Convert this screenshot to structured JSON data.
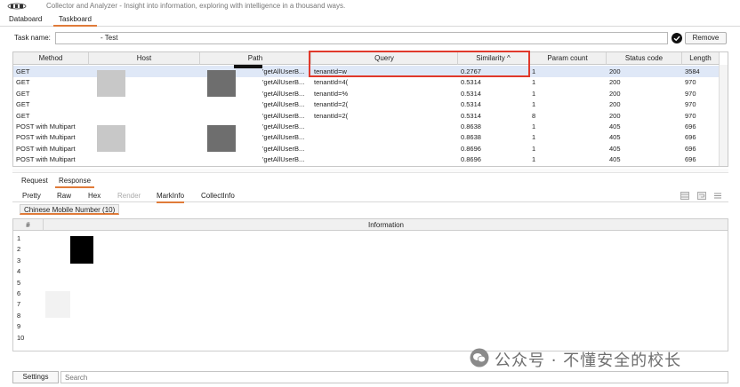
{
  "app": {
    "tagline": "Collector and Analyzer - Insight into information, exploring with intelligence in a thousand ways."
  },
  "main_tabs": [
    {
      "label": "Databoard"
    },
    {
      "label": "Taskboard"
    }
  ],
  "task": {
    "label": "Task name:",
    "value": "- Test",
    "remove_label": "Remove"
  },
  "table": {
    "columns": [
      "Method",
      "Host",
      "Path",
      "Query",
      "Similarity ^",
      "Param count",
      "Status code",
      "Length"
    ],
    "rows": [
      {
        "method": "GET",
        "host": "",
        "path": "'getAllUserB...",
        "query": "tenantId=w",
        "similarity": "0.2767",
        "param_count": "1",
        "status": "200",
        "length": "3584"
      },
      {
        "method": "GET",
        "host": "",
        "path": "'getAllUserB...",
        "query": "tenantId=4(",
        "similarity": "0.5314",
        "param_count": "1",
        "status": "200",
        "length": "970"
      },
      {
        "method": "GET",
        "host": "",
        "path": "'getAllUserB...",
        "query": "tenantId=%",
        "similarity": "0.5314",
        "param_count": "1",
        "status": "200",
        "length": "970"
      },
      {
        "method": "GET",
        "host": "",
        "path": "'getAllUserB...",
        "query": "tenantId=2(",
        "similarity": "0.5314",
        "param_count": "1",
        "status": "200",
        "length": "970"
      },
      {
        "method": "GET",
        "host": "",
        "path": "'getAllUserB...",
        "query": "tenantId=2(",
        "similarity": "0.5314",
        "param_count": "8",
        "status": "200",
        "length": "970"
      },
      {
        "method": "POST with Multipart",
        "host": "",
        "path": "'getAllUserB...",
        "query": "",
        "similarity": "0.8638",
        "param_count": "1",
        "status": "405",
        "length": "696"
      },
      {
        "method": "POST with Multipart",
        "host": "",
        "path": "'getAllUserB...",
        "query": "",
        "similarity": "0.8638",
        "param_count": "1",
        "status": "405",
        "length": "696"
      },
      {
        "method": "POST with Multipart",
        "host": "",
        "path": "'getAllUserB...",
        "query": "",
        "similarity": "0.8696",
        "param_count": "1",
        "status": "405",
        "length": "696"
      },
      {
        "method": "POST with Multipart",
        "host": "",
        "path": "'getAllUserB...",
        "query": "",
        "similarity": "0.8696",
        "param_count": "1",
        "status": "405",
        "length": "696"
      }
    ]
  },
  "detail_tabs": [
    {
      "label": "Request"
    },
    {
      "label": "Response"
    }
  ],
  "sub_tabs": [
    {
      "label": "Pretty"
    },
    {
      "label": "Raw"
    },
    {
      "label": "Hex"
    },
    {
      "label": "Render"
    },
    {
      "label": "MarkInfo"
    },
    {
      "label": "CollectInfo"
    }
  ],
  "group_tab": "Chinese Mobile Number (10)",
  "info_table": {
    "columns": [
      "#",
      "Information"
    ],
    "rows": [
      "1",
      "2",
      "3",
      "4",
      "5",
      "6",
      "7",
      "8",
      "9",
      "10"
    ]
  },
  "watermark": "公众号 · 不懂安全的校长",
  "footer": {
    "settings_label": "Settings",
    "search_placeholder": "Search"
  },
  "colors": {
    "accent": "#e07b39",
    "highlight": "#e0392b",
    "selected_row": "#dfe8f7"
  }
}
